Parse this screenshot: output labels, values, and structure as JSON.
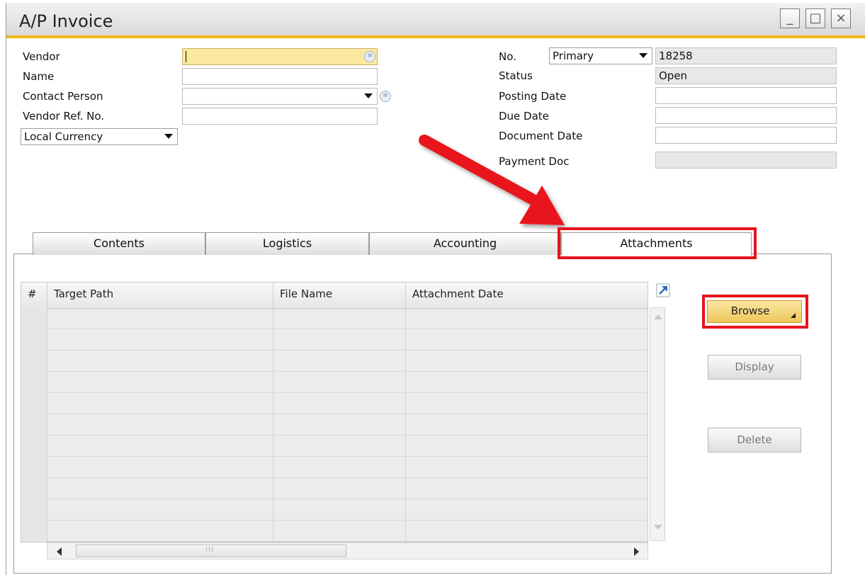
{
  "window": {
    "title": "A/P Invoice",
    "controls": [
      "_",
      "□",
      "×"
    ]
  },
  "header_left": {
    "vendor_label": "Vendor",
    "name_label": "Name",
    "contact_label": "Contact Person",
    "vendor_ref_label": "Vendor Ref. No.",
    "currency_value": "Local Currency"
  },
  "header_right": {
    "no_label": "No.",
    "series_value": "Primary",
    "doc_number": "18258",
    "status_label": "Status",
    "status_value": "Open",
    "posting_date_label": "Posting Date",
    "due_date_label": "Due Date",
    "document_date_label": "Document Date",
    "payment_doc_label": "Payment Doc"
  },
  "tabs": [
    {
      "label": "Contents"
    },
    {
      "label": "Logistics"
    },
    {
      "label": "Accounting"
    },
    {
      "label": "Attachments"
    }
  ],
  "attachments_grid": {
    "columns": [
      "#",
      "Target Path",
      "File Name",
      "Attachment Date"
    ],
    "rows": [
      [],
      [],
      [],
      [],
      [],
      [],
      [],
      [],
      [],
      [],
      []
    ]
  },
  "buttons": {
    "browse": "Browse",
    "display": "Display",
    "delete": "Delete"
  },
  "annotation": {
    "highlight_color": "#e8141c",
    "arrow_color": "#e8141c"
  },
  "colors": {
    "accent": "#f0b51c",
    "mandatory_field": "#fbe9a0"
  }
}
